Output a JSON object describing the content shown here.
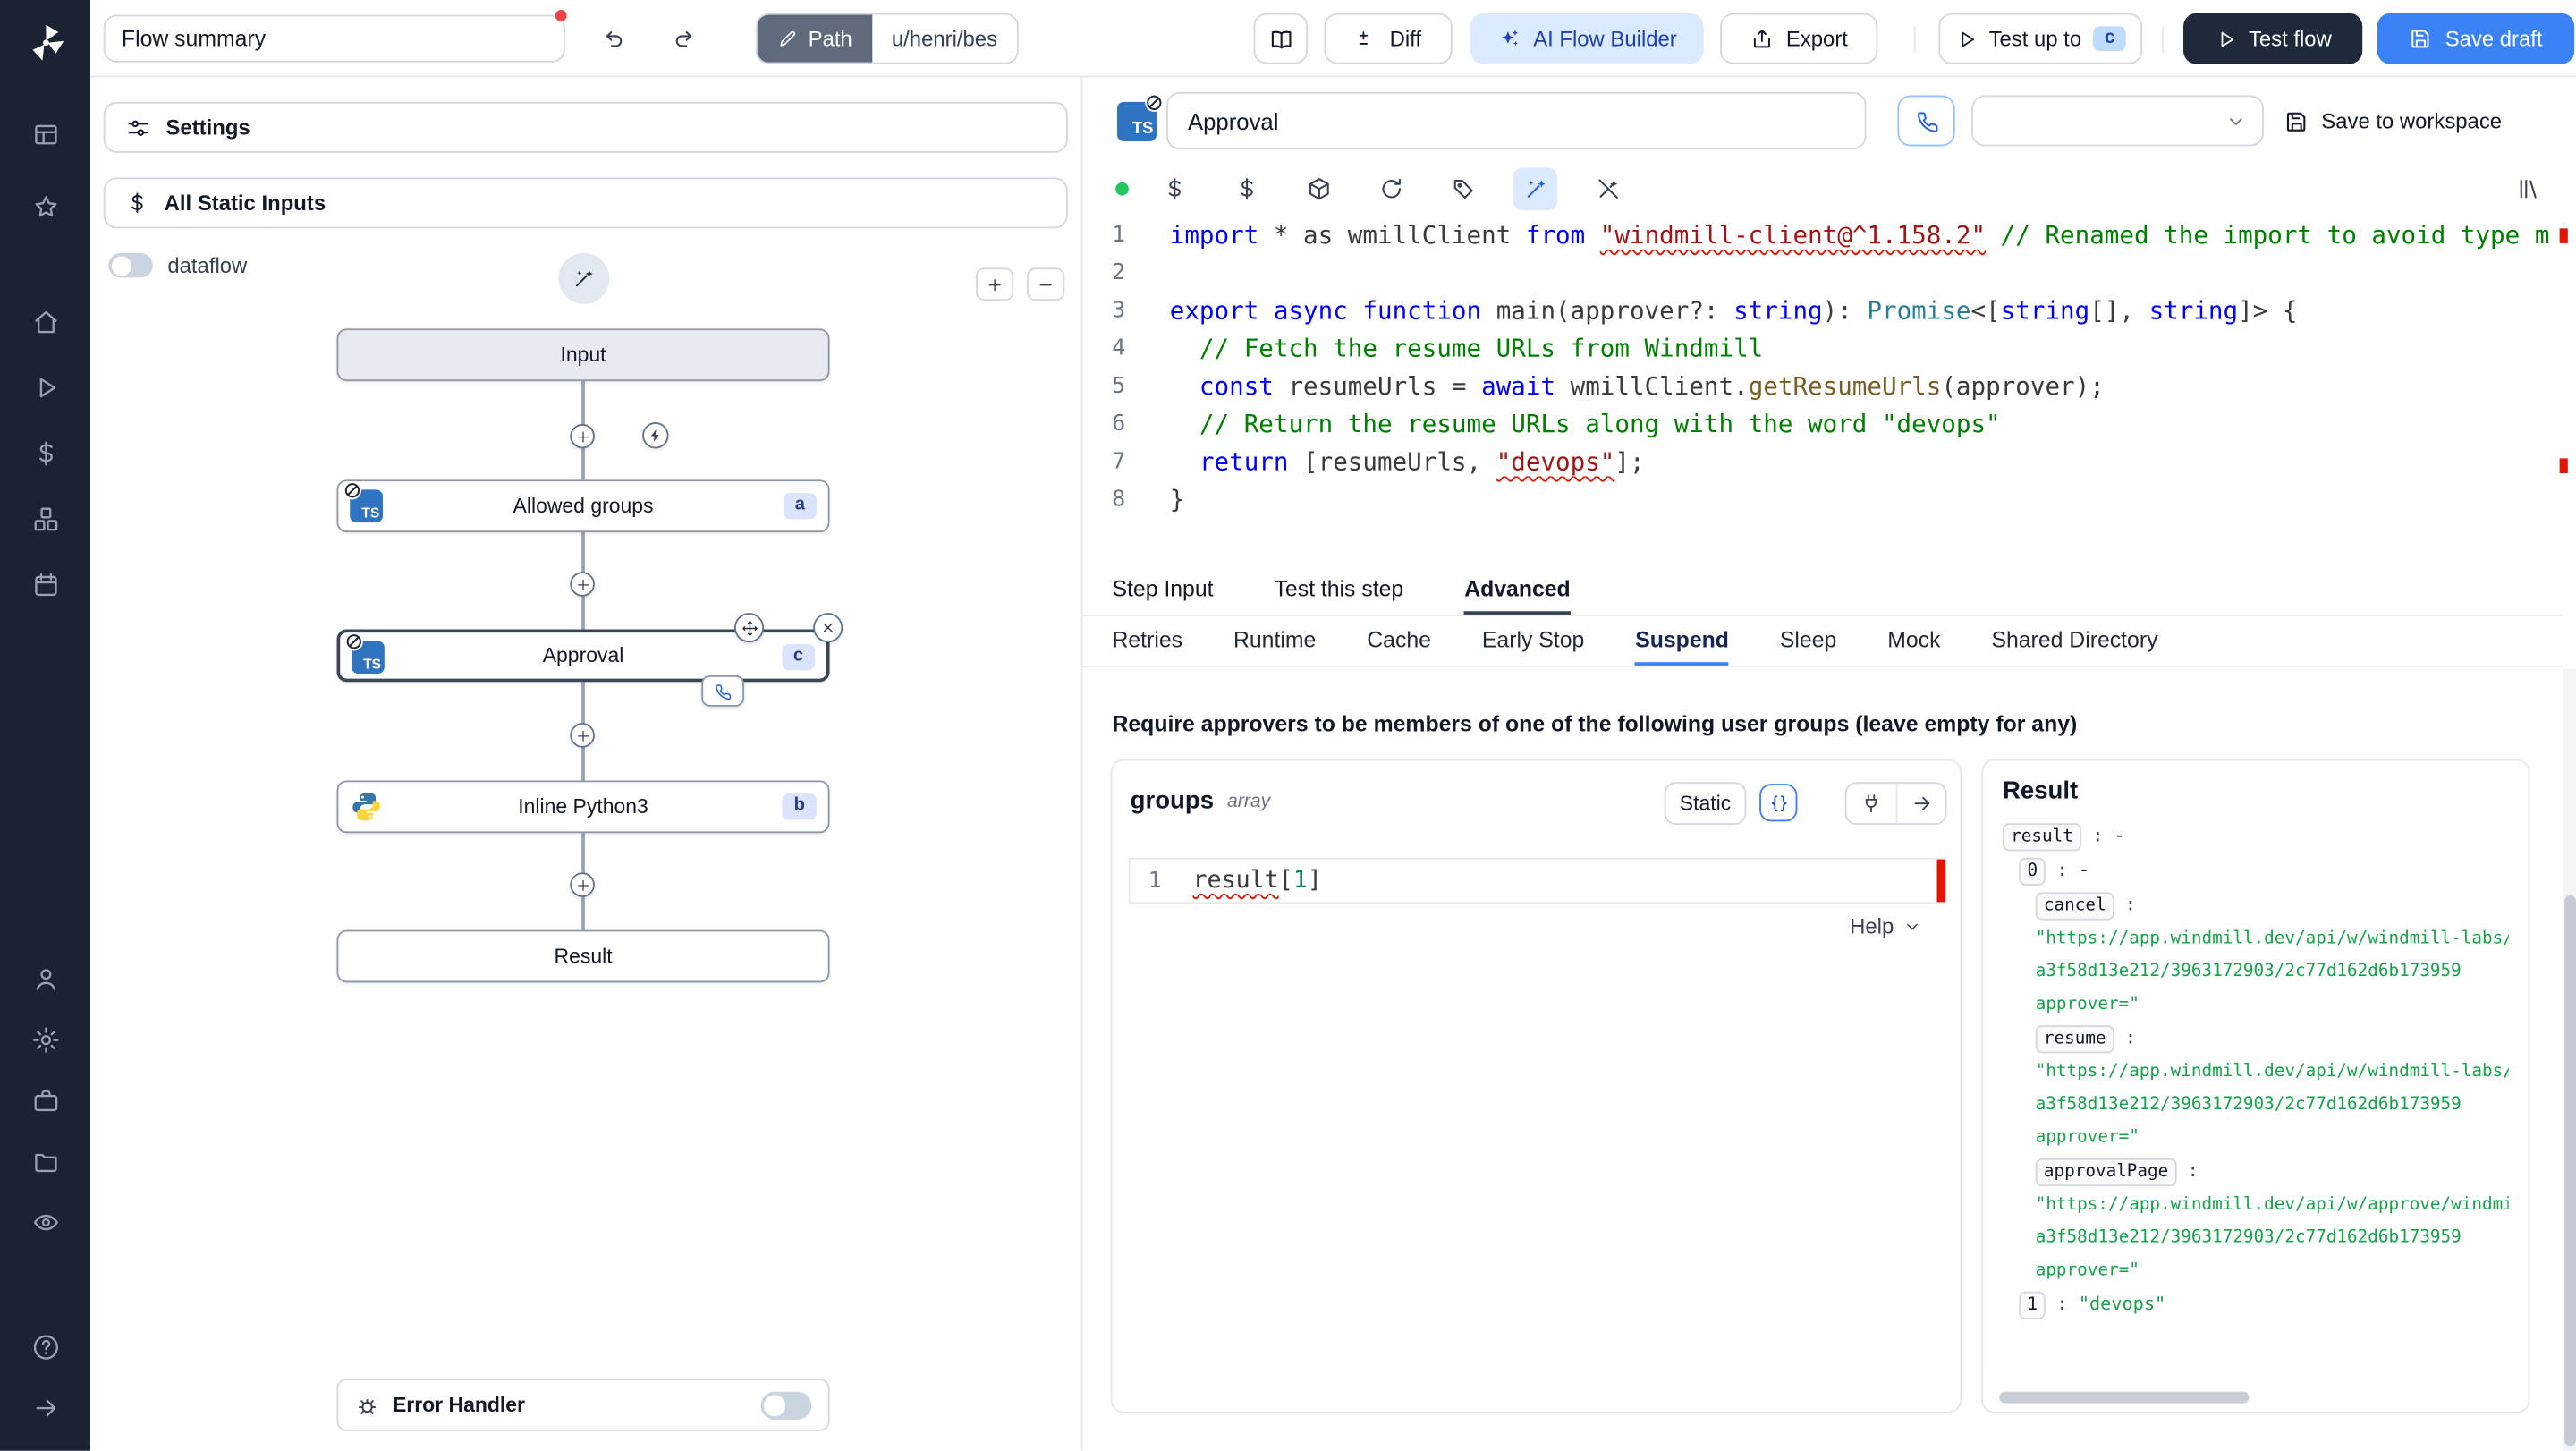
{
  "colors": {
    "accent": "#3b82f6",
    "ai_chip_bg": "#dbeafe",
    "dark_button": "#1e293b",
    "error": "#e51400",
    "success_dot": "#22c55e",
    "sidebar_bg": "#1b2231"
  },
  "sidebar": {
    "group1_icons": [
      "grid",
      "star"
    ],
    "group2_icons": [
      "home",
      "play",
      "dollar",
      "boxes",
      "calendar"
    ],
    "bottom1_icons": [
      "user",
      "gear",
      "briefcase",
      "folder",
      "eye"
    ],
    "bottom2_icons": [
      "help",
      "arrow-right"
    ]
  },
  "topbar": {
    "flow_summary": "Flow summary",
    "path_label": "Path",
    "path_value": "u/henri/bes",
    "diff_label": "Diff",
    "ai_flow_builder_label": "AI Flow Builder",
    "export_label": "Export",
    "test_up_to_label": "Test up to",
    "test_up_to_badge": "c",
    "test_flow_label": "Test flow",
    "save_draft_label": "Save draft"
  },
  "flow": {
    "settings_label": "Settings",
    "all_static_inputs_label": "All Static Inputs",
    "dataflow_label": "dataflow",
    "error_handler_label": "Error Handler",
    "nodes": {
      "input": {
        "label": "Input"
      },
      "allowed_groups": {
        "label": "Allowed groups",
        "badge": "a",
        "lang": "TS"
      },
      "approval": {
        "label": "Approval",
        "badge": "c",
        "lang": "TS"
      },
      "python": {
        "label": "Inline Python3",
        "badge": "b"
      },
      "result": {
        "label": "Result"
      }
    }
  },
  "editor": {
    "step_name": "Approval",
    "lang_badge": "TS",
    "save_to_workspace_label": "Save to workspace",
    "toolbar_icons": [
      "dollar",
      "dollar",
      "box",
      "refresh",
      "tag",
      "wand",
      "wand-off"
    ],
    "toolbar_active_index": 5,
    "code": {
      "lines": [
        {
          "n": 1,
          "tokens": [
            {
              "t": "import",
              "c": "kw"
            },
            {
              "t": " * as wmillClient ",
              "c": "pl"
            },
            {
              "t": "from",
              "c": "kw"
            },
            {
              "t": " ",
              "c": "pl"
            },
            {
              "t": "\"windmill-client@^1.158.2\"",
              "c": "str sq"
            },
            {
              "t": " ",
              "c": "pl"
            },
            {
              "t": "// Renamed the import to avoid type m",
              "c": "cmt"
            }
          ]
        },
        {
          "n": 2,
          "tokens": []
        },
        {
          "n": 3,
          "tokens": [
            {
              "t": "export",
              "c": "kw"
            },
            {
              "t": " ",
              "c": "pl"
            },
            {
              "t": "async",
              "c": "kw"
            },
            {
              "t": " ",
              "c": "pl"
            },
            {
              "t": "function",
              "c": "kw"
            },
            {
              "t": " main(approver?: ",
              "c": "pl"
            },
            {
              "t": "string",
              "c": "kw"
            },
            {
              "t": "): ",
              "c": "pl"
            },
            {
              "t": "Promise",
              "c": "cls"
            },
            {
              "t": "<[",
              "c": "pl"
            },
            {
              "t": "string",
              "c": "kw"
            },
            {
              "t": "[], ",
              "c": "pl"
            },
            {
              "t": "string",
              "c": "kw"
            },
            {
              "t": "]> {",
              "c": "pl"
            }
          ]
        },
        {
          "n": 4,
          "tokens": [
            {
              "t": "  ",
              "c": "pl"
            },
            {
              "t": "// Fetch the resume URLs from Windmill",
              "c": "cmt"
            }
          ]
        },
        {
          "n": 5,
          "tokens": [
            {
              "t": "  ",
              "c": "pl"
            },
            {
              "t": "const",
              "c": "kw"
            },
            {
              "t": " resumeUrls = ",
              "c": "pl"
            },
            {
              "t": "await",
              "c": "kw"
            },
            {
              "t": " wmillClient.",
              "c": "pl"
            },
            {
              "t": "getResumeUrls",
              "c": "fn"
            },
            {
              "t": "(approver);",
              "c": "pl"
            }
          ]
        },
        {
          "n": 6,
          "tokens": [
            {
              "t": "  ",
              "c": "pl"
            },
            {
              "t": "// Return the resume URLs along with the word \"devops\"",
              "c": "cmt"
            }
          ]
        },
        {
          "n": 7,
          "tokens": [
            {
              "t": "  ",
              "c": "pl"
            },
            {
              "t": "return",
              "c": "kw"
            },
            {
              "t": " [resumeUrls, ",
              "c": "pl"
            },
            {
              "t": "\"devops\"",
              "c": "str sq"
            },
            {
              "t": "];",
              "c": "pl"
            }
          ]
        },
        {
          "n": 8,
          "tokens": [
            {
              "t": "}",
              "c": "pl"
            }
          ]
        }
      ]
    },
    "tabs": [
      {
        "label": "Step Input"
      },
      {
        "label": "Test this step"
      },
      {
        "label": "Advanced",
        "active": true
      }
    ],
    "advanced_tabs": [
      {
        "label": "Retries"
      },
      {
        "label": "Runtime"
      },
      {
        "label": "Cache"
      },
      {
        "label": "Early Stop"
      },
      {
        "label": "Suspend",
        "active": true
      },
      {
        "label": "Sleep"
      },
      {
        "label": "Mock"
      },
      {
        "label": "Shared Directory"
      }
    ],
    "suspend": {
      "description": "Require approvers to be members of one of the following user groups (leave empty for any)",
      "field_name": "groups",
      "field_type": "array",
      "static_label": "Static",
      "editor_line_number": "1",
      "editor_tokens": [
        {
          "t": "result",
          "c": "pl sq"
        },
        {
          "t": "[",
          "c": "pl"
        },
        {
          "t": "1",
          "c": "num"
        },
        {
          "t": "]",
          "c": "pl"
        }
      ],
      "help_label": "Help"
    },
    "result_panel": {
      "title": "Result",
      "entries": [
        {
          "key": "result",
          "value": "-",
          "indent": 0,
          "vclass": "plain"
        },
        {
          "key": "0",
          "value": "-",
          "indent": 1,
          "vclass": "plain"
        },
        {
          "key": "cancel",
          "indent": 2,
          "lines": [
            "\"https://app.windmill.dev/api/w/windmill-labs/jobs",
            "a3f58d13e212/3963172903/2c77d162d6b173959",
            "approver=\""
          ]
        },
        {
          "key": "resume",
          "indent": 2,
          "lines": [
            "\"https://app.windmill.dev/api/w/windmill-labs/jobs",
            "a3f58d13e212/3963172903/2c77d162d6b173959",
            "approver=\""
          ]
        },
        {
          "key": "approvalPage",
          "indent": 2,
          "lines": [
            "\"https://app.windmill.dev/api/w/approve/windmill-labs/C",
            "a3f58d13e212/3963172903/2c77d162d6b173959",
            "approver=\""
          ]
        },
        {
          "key": "1",
          "value": "\"devops\"",
          "indent": 1,
          "vclass": "green"
        }
      ]
    }
  }
}
